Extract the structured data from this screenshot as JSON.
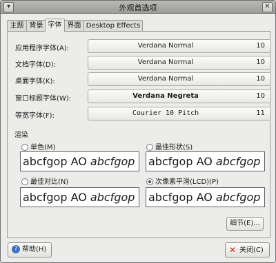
{
  "window": {
    "title": "外观首选项"
  },
  "tabs": [
    {
      "label": "主题"
    },
    {
      "label": "背景"
    },
    {
      "label": "字体"
    },
    {
      "label": "界面"
    },
    {
      "label": "Desktop Effects"
    }
  ],
  "fonts": {
    "app": {
      "label": "应用程序字体(A):",
      "font": "Verdana Normal",
      "size": "10"
    },
    "doc": {
      "label": "文档字体(D):",
      "font": "Verdana Normal",
      "size": "10"
    },
    "desktop": {
      "label": "桌面字体(K):",
      "font": "Verdana Normal",
      "size": "10"
    },
    "wintitle": {
      "label": "窗口标题字体(W):",
      "font": "Verdana Negreta",
      "size": "10"
    },
    "mono": {
      "label": "等宽字体(F):",
      "font": "Courier 10 Pitch",
      "size": "11"
    }
  },
  "rendering": {
    "title": "渲染",
    "sample_plain": "abcfgop AO ",
    "sample_italic": "abcfgop",
    "options": [
      {
        "label": "单色(M)",
        "selected": false
      },
      {
        "label": "最佳形状(S)",
        "selected": false
      },
      {
        "label": "最佳对比(N)",
        "selected": false
      },
      {
        "label": "次像素平滑(LCD)(P)",
        "selected": true
      }
    ]
  },
  "buttons": {
    "details": "细节(E)...",
    "help": "帮助(H)",
    "close": "关闭(C)"
  },
  "icons": {
    "help": "help-icon",
    "close": "close-x-icon"
  },
  "colors": {
    "close_icon": "#cc1f1f"
  }
}
